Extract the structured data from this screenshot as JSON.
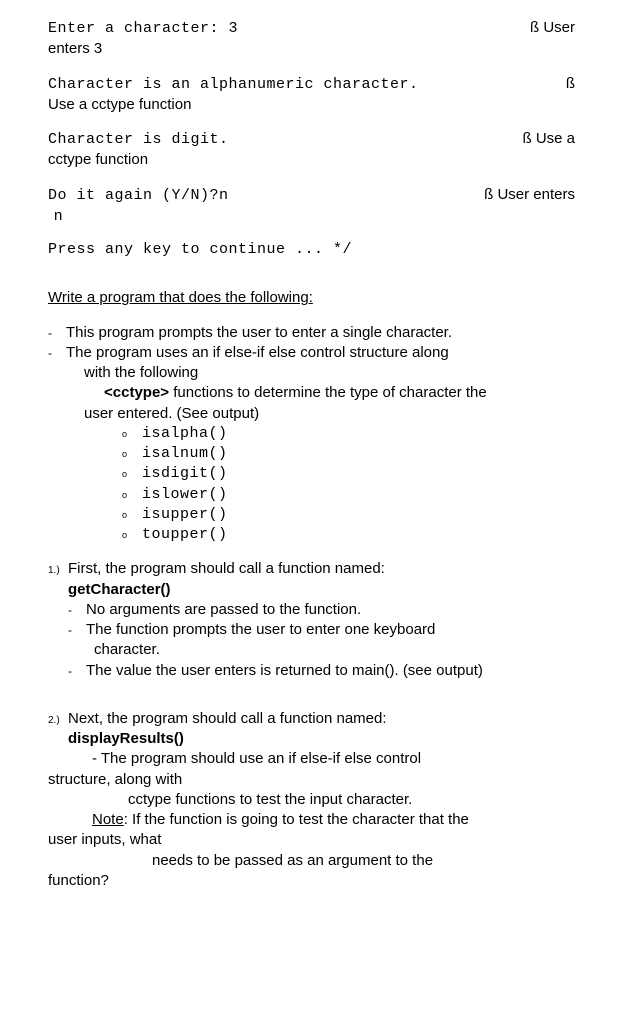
{
  "term": {
    "line1_left_mono": "Enter a character:  3",
    "line1_right": "ß User",
    "line1b": "enters 3",
    "line2_left_mono": "Character is an alphanumeric character.",
    "line2_right": "ß",
    "line2b": "Use a cctype function",
    "line3_left_mono": "Character is digit.",
    "line3_right": "ß Use a",
    "line3b": "cctype function",
    "line4_left_mono": "Do it again (Y/N)?n",
    "line4_right": "ß User enters",
    "line4b": "n",
    "line5": "Press any key to continue ... */"
  },
  "heading": "Write a program that does the following:",
  "intro": {
    "p1": "This program prompts the user to enter a single character.",
    "p2_a": "The program uses an  if  else-if  else  control structure along",
    "p2_b": "with the following",
    "p2_c_pre": "<cctype>",
    "p2_c_post": " functions to determine the type of character the",
    "p2_d": "user entered.  (See output)"
  },
  "funcs": {
    "f1": "isalpha()",
    "f2": "isalnum()",
    "f3": "isdigit()",
    "f4": "islower()",
    "f5": "isupper()",
    "f6": "toupper()"
  },
  "s1": {
    "num": "1.)",
    "head": "First, the program should call a function named:",
    "name": "getCharacter()",
    "a": "No arguments are passed to the function.",
    "b1": "The function prompts the user to enter one keyboard",
    "b2": "character.",
    "c": "The value the user enters is returned to main().  (see output)"
  },
  "s2": {
    "num": "2.)",
    "head": "Next, the program should call a function named:",
    "name": "displayResults()",
    "a1": "-  The program should use an if   else-if   else  control",
    "a2": "structure, along with",
    "a3": "cctype functions to test the input character.",
    "note_label": "Note",
    "note_rest": ":   If the function is going to test the character that the",
    "b2": "user inputs, what",
    "b3": "needs to be passed as an argument to the",
    "b4": "function?"
  },
  "dash": "-",
  "circ": "o"
}
